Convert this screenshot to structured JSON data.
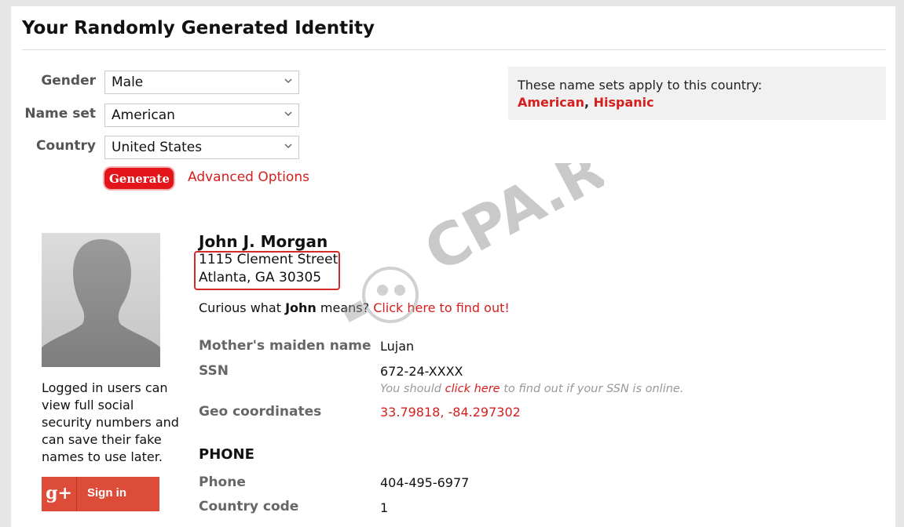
{
  "page_title": "Your Randomly Generated Identity",
  "form": {
    "gender_label": "Gender",
    "gender_value": "Male",
    "nameset_label": "Name set",
    "nameset_value": "American",
    "country_label": "Country",
    "country_value": "United States",
    "generate_label": "Generate",
    "advanced_label": "Advanced Options"
  },
  "info": {
    "text": "These name sets apply to this country:",
    "link1": "American",
    "sep": ", ",
    "link2": "Hispanic"
  },
  "identity": {
    "name": "John J. Morgan",
    "address_line1": "1115 Clement Street",
    "address_line2": "Atlanta, GA 30305",
    "curious_prefix": "Curious what ",
    "first_name": "John",
    "curious_mid": " means? ",
    "curious_link": "Click here to find out!"
  },
  "details": {
    "maiden_label": "Mother's maiden name",
    "maiden_value": "Lujan",
    "ssn_label": "SSN",
    "ssn_value": "672-24-XXXX",
    "ssn_note_prefix": "You should ",
    "ssn_note_link": "click here",
    "ssn_note_suffix": " to find out if your SSN is online.",
    "geo_label": "Geo coordinates",
    "geo_value": "33.79818, -84.297302"
  },
  "phone_section": {
    "heading": "PHONE",
    "phone_label": "Phone",
    "phone_value": "404-495-6977",
    "code_label": "Country code",
    "code_value": "1"
  },
  "sidebar": {
    "login_note": "Logged in users can view full social security numbers and can save their fake names to use later.",
    "gplus_logo": "g+",
    "gplus_label": "Sign in"
  },
  "watermark": {
    "text": "CPA.RIP"
  },
  "colors": {
    "accent": "#d71e1e",
    "button": "#e3151b",
    "google": "#dd4b39"
  }
}
